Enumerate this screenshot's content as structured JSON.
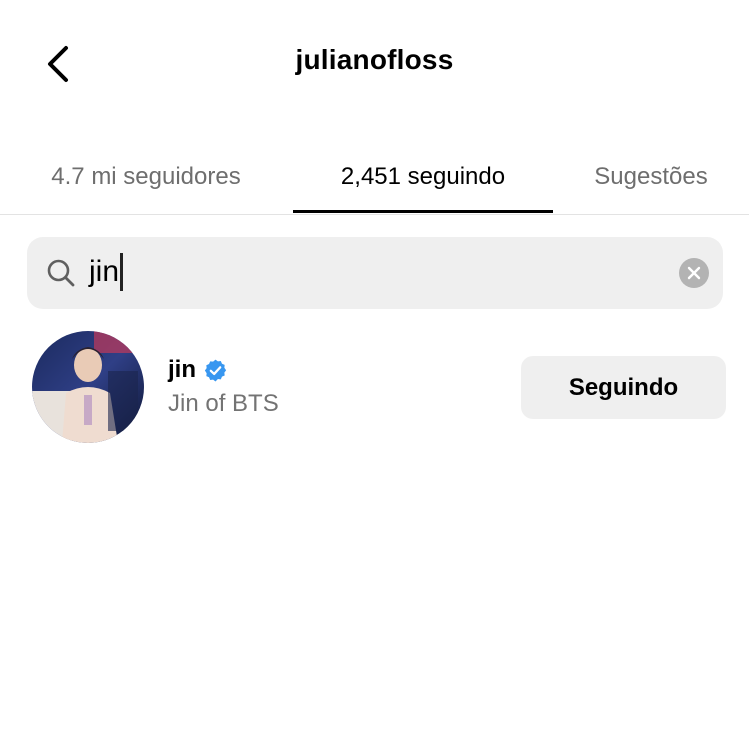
{
  "header": {
    "title": "julianofloss",
    "back_icon": "chevron-left-icon"
  },
  "tabs": [
    {
      "label": "4.7 mi seguidores",
      "active": false
    },
    {
      "label": "2,451 seguindo",
      "active": true
    },
    {
      "label": "Sugestões",
      "active": false
    }
  ],
  "search": {
    "value": "jin",
    "icon": "search-icon",
    "clear_icon": "clear-icon"
  },
  "results": [
    {
      "username": "jin",
      "verified": true,
      "full_name": "Jin of BTS",
      "button_label": "Seguindo"
    }
  ],
  "colors": {
    "verified_badge": "#3897f0",
    "secondary_text": "#737373",
    "search_bg": "#efefef",
    "button_bg": "#efefef"
  }
}
